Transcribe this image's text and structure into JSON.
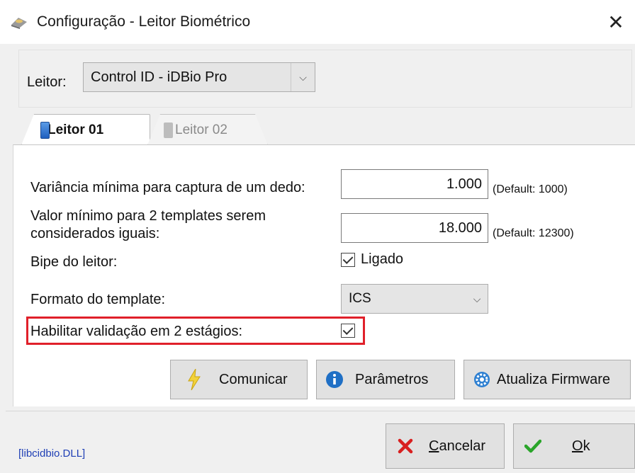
{
  "window": {
    "title": "Configuração - Leitor Biométrico",
    "title_icon": "fingerprint-reader-icon",
    "close_icon": "close-icon"
  },
  "reader": {
    "label": "Leitor:",
    "selected": "Control ID - iDBio Pro"
  },
  "tabs": [
    {
      "label": "Leitor 01",
      "active": true
    },
    {
      "label": "Leitor 02",
      "active": false
    }
  ],
  "settings": {
    "variance_label": "Variância mínima para captura de um dedo:",
    "variance_value": "1.000",
    "variance_default": "(Default: 1000)",
    "templates_label_line1": "Valor mínimo para 2 templates serem",
    "templates_label_line2": "considerados iguais:",
    "templates_value": "18.000",
    "templates_default": "(Default: 12300)",
    "beep_label": "Bipe do leitor:",
    "beep_check_label": "Ligado",
    "beep_checked": true,
    "format_label": "Formato do template:",
    "format_value": "ICS",
    "two_stage_label": "Habilitar validação em 2 estágios:",
    "two_stage_checked": true,
    "highlight_color": "#e0202a"
  },
  "actions": {
    "communicate": "Comunicar",
    "parameters": "Parâmetros",
    "firmware": "Atualiza Firmware"
  },
  "footer": {
    "cancel_mnemonic": "C",
    "cancel_rest": "ancelar",
    "ok_mnemonic": "O",
    "ok_rest": "k",
    "dll": "[libcidbio.DLL]"
  }
}
